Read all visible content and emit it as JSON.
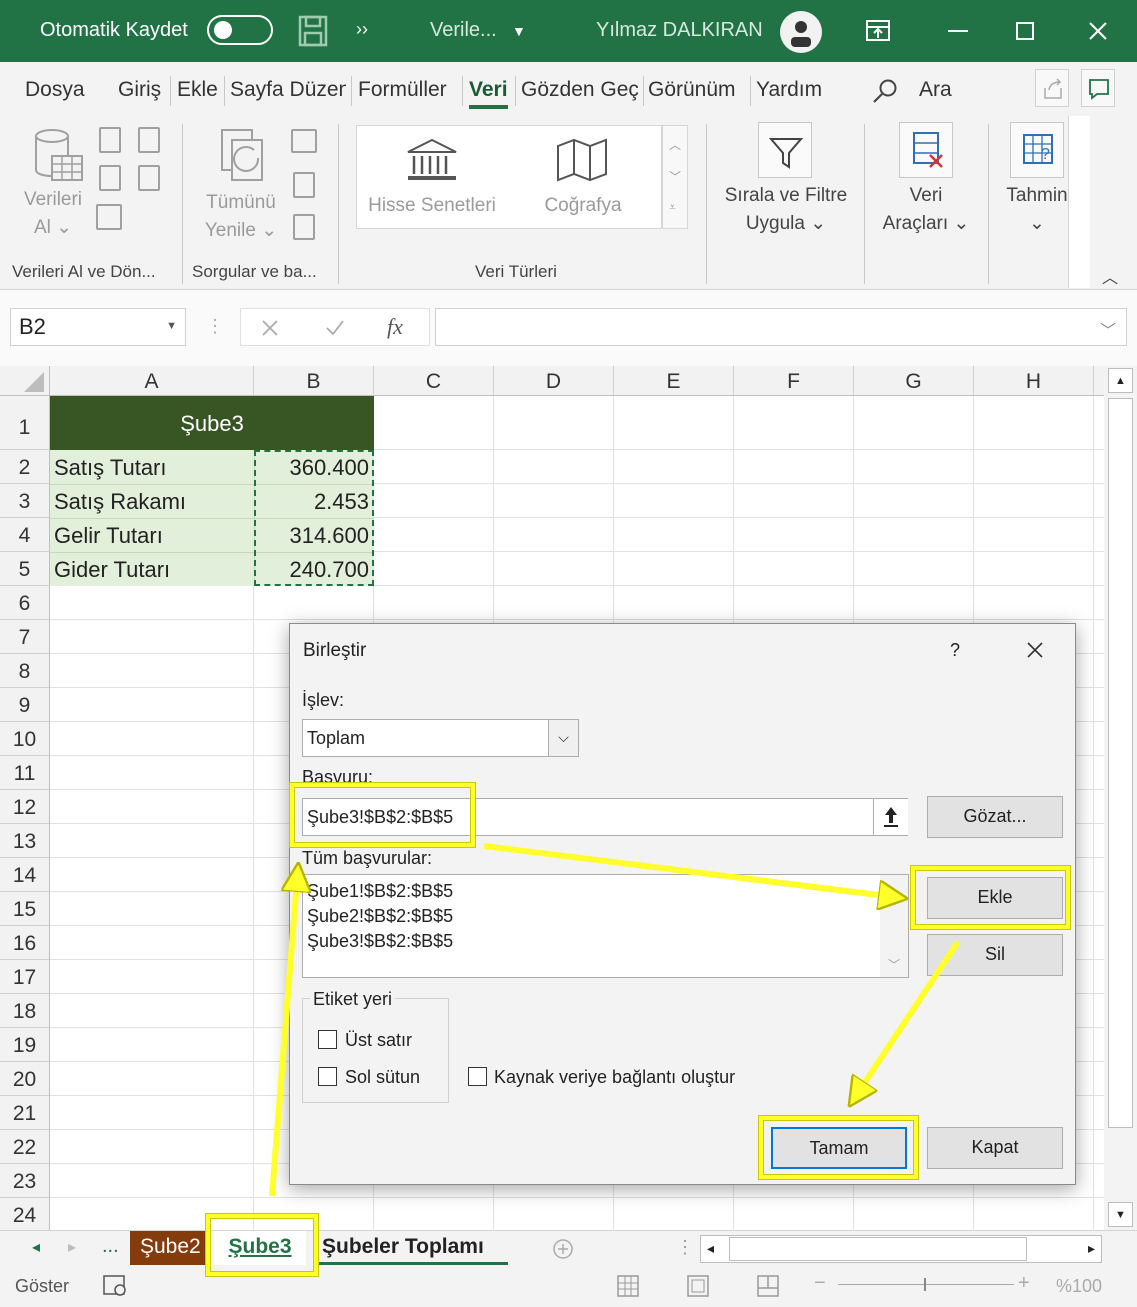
{
  "titlebar": {
    "autosave_label": "Otomatik Kaydet",
    "more": "››",
    "filename": "Verile...",
    "user": "Yılmaz DALKIRAN"
  },
  "menu": {
    "items": [
      "Dosya",
      "Giriş",
      "Ekle",
      "Sayfa Düzeni",
      "Formüller",
      "Veri",
      "Gözden Geçir",
      "Görünüm",
      "Yardım"
    ],
    "search": "Ara"
  },
  "ribbon": {
    "get_data": [
      "Verileri",
      "Al ⌄"
    ],
    "refresh": [
      "Tümünü",
      "Yenile ⌄"
    ],
    "stocks": "Hisse Senetleri",
    "geography": "Coğrafya",
    "sort_filter": [
      "Sırala ve Filtre",
      "Uygula ⌄"
    ],
    "data_tools": [
      "Veri",
      "Araçları ⌄"
    ],
    "forecast": [
      "Tahmin",
      "⌄"
    ],
    "groups": [
      "Verileri Al ve Dön...",
      "Sorgular ve ba...",
      "Veri Türleri"
    ]
  },
  "formula": {
    "namebox": "B2",
    "fx": "fx",
    "content": ""
  },
  "grid": {
    "columns": [
      "A",
      "B",
      "C",
      "D",
      "E",
      "F",
      "G",
      "H"
    ],
    "rows": [
      "1",
      "2",
      "3",
      "4",
      "5",
      "6",
      "7",
      "8",
      "9",
      "10",
      "11",
      "12",
      "13",
      "14",
      "15",
      "16",
      "17",
      "18",
      "19",
      "20",
      "21",
      "22",
      "23",
      "24"
    ],
    "header_cell": "Şube3",
    "labels": [
      "Satış Tutarı",
      "Satış Rakamı",
      "Gelir Tutarı",
      "Gider Tutarı"
    ],
    "values": [
      "360.400",
      "2.453",
      "314.600",
      "240.700"
    ]
  },
  "sheet_tabs": {
    "ellipsis": "...",
    "tabs": [
      "Şube2",
      "Şube3",
      "Şubeler Toplamı"
    ]
  },
  "status": {
    "mode": "Göster",
    "zoom": "%100"
  },
  "dialog": {
    "title": "Birleştir",
    "help": "?",
    "function_label": "İşlev:",
    "function_value": "Toplam",
    "reference_label": "Başvuru:",
    "reference_value": "Şube3!$B$2:$B$5",
    "browse": "Gözat...",
    "all_refs_label": "Tüm başvurular:",
    "all_refs": [
      "Şube1!$B$2:$B$5",
      "Şube2!$B$2:$B$5",
      "Şube3!$B$2:$B$5"
    ],
    "add": "Ekle",
    "delete": "Sil",
    "labels_group": "Etiket yeri",
    "top_row": "Üst satır",
    "left_column": "Sol sütun",
    "link": "Kaynak veriye bağlantı oluştur",
    "ok": "Tamam",
    "close": "Kapat"
  },
  "colors": {
    "excel_green": "#217346",
    "header_fill": "#375623",
    "data_fill": "#e2efda",
    "highlight": "#ffff2a"
  }
}
